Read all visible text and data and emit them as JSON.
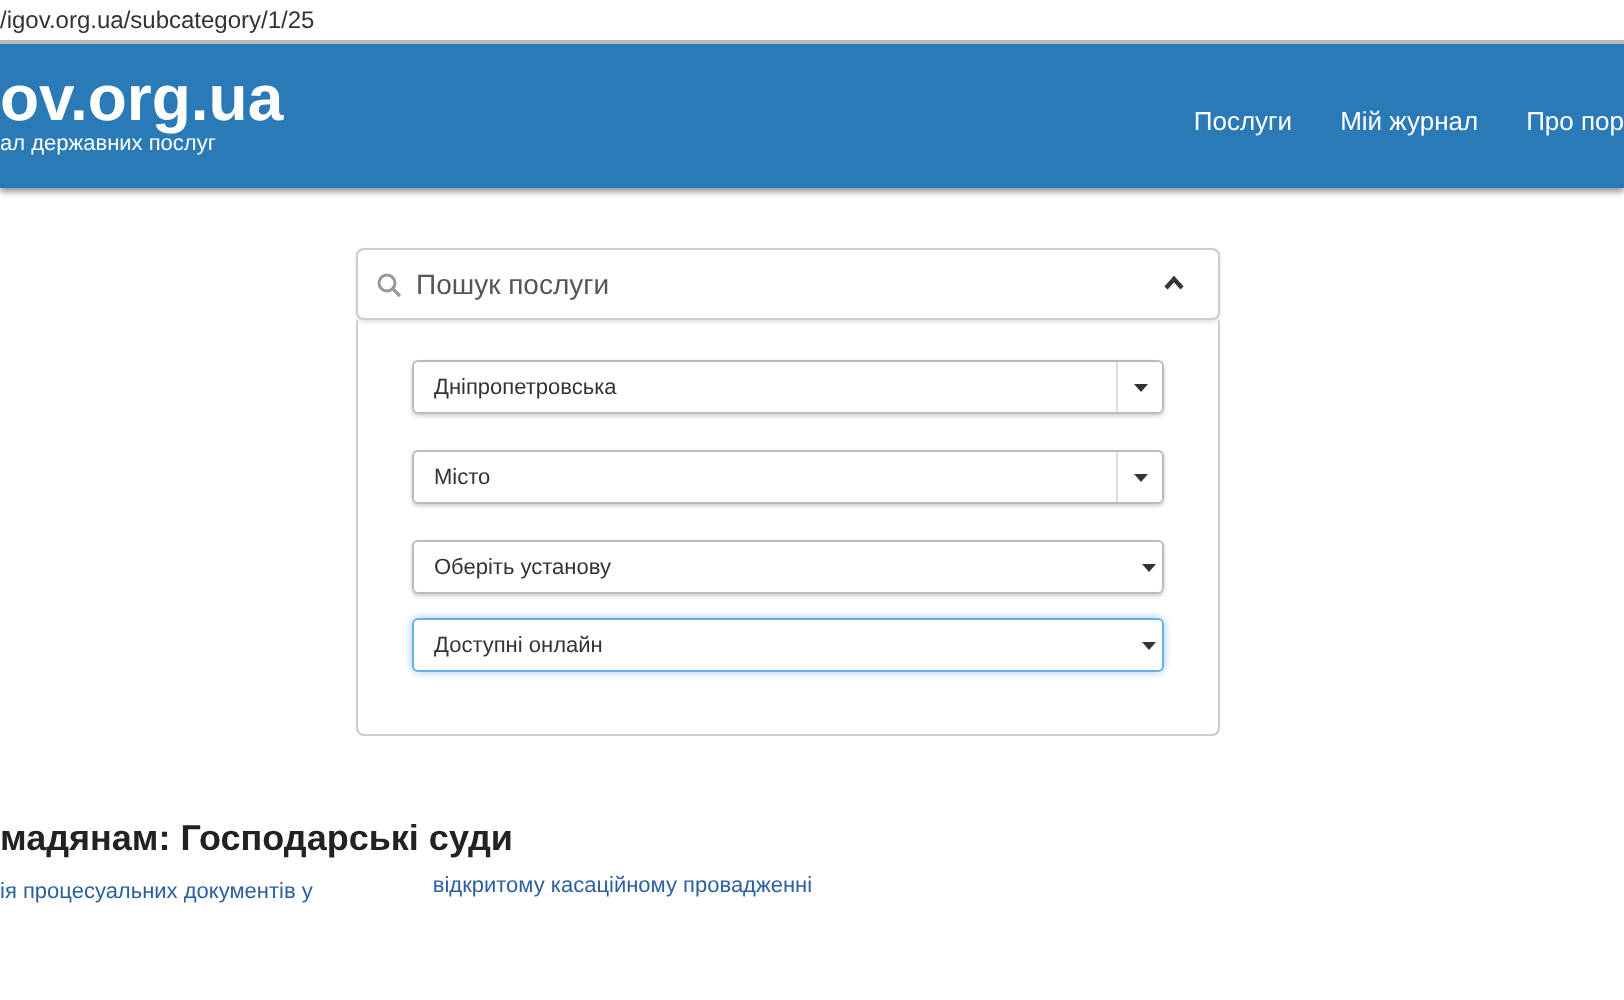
{
  "address_bar": {
    "url": "/igov.org.ua/subcategory/1/25"
  },
  "header": {
    "logo": "ov.org.ua",
    "subtitle": "ал державних послуг",
    "nav": [
      {
        "label": "Послуги"
      },
      {
        "label": "Мій журнал"
      },
      {
        "label": "Про пор"
      }
    ]
  },
  "search": {
    "placeholder": "Пошук послуги",
    "expanded": true
  },
  "filters": [
    {
      "kind": "combo",
      "value": "Дніпропетровська",
      "focused": false
    },
    {
      "kind": "combo",
      "value": "Місто",
      "focused": false
    },
    {
      "kind": "select",
      "value": "Оберіть установу",
      "focused": false
    },
    {
      "kind": "select",
      "value": "Доступні онлайн",
      "focused": true
    }
  ],
  "section": {
    "heading": "мадянам: Господарські суди",
    "links": [
      "ія процесуальних документів у",
      "відкритому касаційному провадженні"
    ]
  }
}
